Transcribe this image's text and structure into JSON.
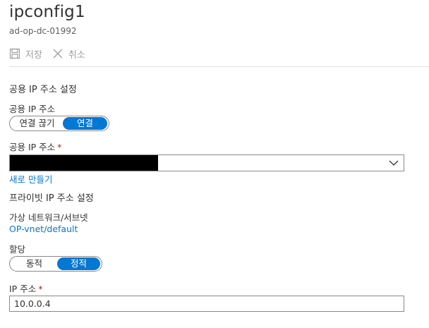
{
  "header": {
    "title": "ipconfig1",
    "subtitle": "ad-op-dc-01992"
  },
  "toolbar": {
    "save_label": "저장",
    "cancel_label": "취소"
  },
  "public_ip": {
    "section_title": "공용 IP 주소 설정",
    "toggle_label": "공용 IP 주소",
    "toggle_options": [
      "연결 끊기",
      "연결"
    ],
    "toggle_selected": "연결",
    "select_label": "공용 IP 주소",
    "required_mark": "*",
    "create_new_link": "새로 만들기"
  },
  "private_ip": {
    "section_title": "프라이빗 IP 주소 설정",
    "vnet_label": "가상 네트워크/서브넷",
    "vnet_value": "OP-vnet/default",
    "assignment_label": "할당",
    "assignment_options": [
      "동적",
      "정적"
    ],
    "assignment_selected": "정적",
    "ip_label": "IP 주소",
    "required_mark": "*",
    "ip_value": "10.0.0.4"
  },
  "colors": {
    "accent": "#0078d4",
    "required": "#a4262c",
    "disabled": "#a19f9d"
  }
}
